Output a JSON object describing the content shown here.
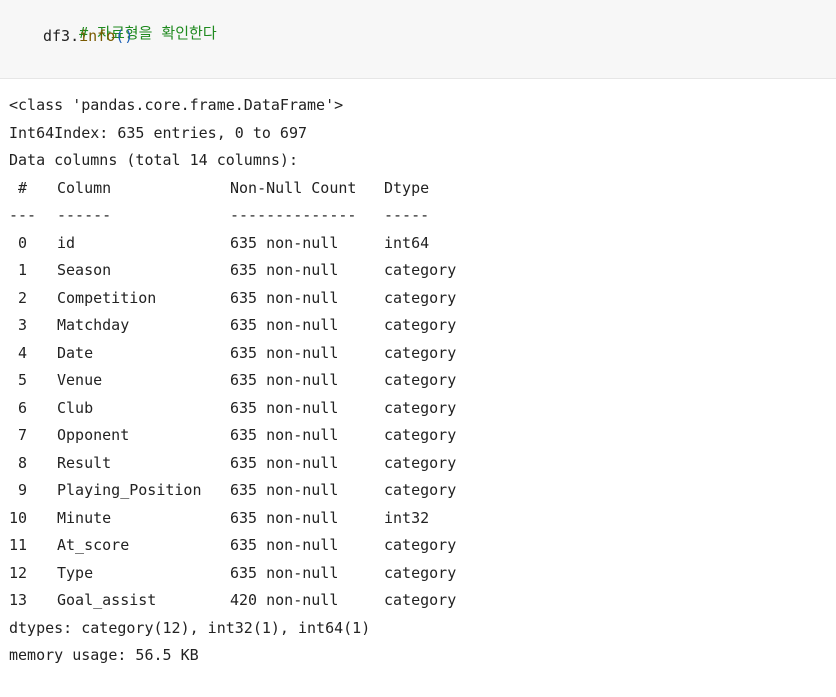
{
  "code_cell": {
    "comment": "# 자료형을 확인한다",
    "object": "df3",
    "dot": ".",
    "method": "info",
    "parens": "()"
  },
  "output": {
    "class_line": "<class 'pandas.core.frame.DataFrame'>",
    "index_line": "Int64Index: 635 entries, 0 to 697",
    "columns_line": "Data columns (total 14 columns):",
    "header": {
      "num": "#",
      "column": "Column",
      "non_null": "Non-Null Count",
      "dtype": "Dtype"
    },
    "separator": {
      "num": "---",
      "column": "------",
      "non_null": "--------------",
      "dtype": "-----"
    },
    "rows": [
      {
        "num": "0",
        "column": "id",
        "non_null": "635 non-null",
        "dtype": "int64"
      },
      {
        "num": "1",
        "column": "Season",
        "non_null": "635 non-null",
        "dtype": "category"
      },
      {
        "num": "2",
        "column": "Competition",
        "non_null": "635 non-null",
        "dtype": "category"
      },
      {
        "num": "3",
        "column": "Matchday",
        "non_null": "635 non-null",
        "dtype": "category"
      },
      {
        "num": "4",
        "column": "Date",
        "non_null": "635 non-null",
        "dtype": "category"
      },
      {
        "num": "5",
        "column": "Venue",
        "non_null": "635 non-null",
        "dtype": "category"
      },
      {
        "num": "6",
        "column": "Club",
        "non_null": "635 non-null",
        "dtype": "category"
      },
      {
        "num": "7",
        "column": "Opponent",
        "non_null": "635 non-null",
        "dtype": "category"
      },
      {
        "num": "8",
        "column": "Result",
        "non_null": "635 non-null",
        "dtype": "category"
      },
      {
        "num": "9",
        "column": "Playing_Position",
        "non_null": "635 non-null",
        "dtype": "category"
      },
      {
        "num": "10",
        "column": "Minute",
        "non_null": "635 non-null",
        "dtype": "int32"
      },
      {
        "num": "11",
        "column": "At_score",
        "non_null": "635 non-null",
        "dtype": "category"
      },
      {
        "num": "12",
        "column": "Type",
        "non_null": "635 non-null",
        "dtype": "category"
      },
      {
        "num": "13",
        "column": "Goal_assist",
        "non_null": "420 non-null",
        "dtype": "category"
      }
    ],
    "dtypes_line": "dtypes: category(12), int32(1), int64(1)",
    "memory_line": "memory usage: 56.5 KB"
  }
}
